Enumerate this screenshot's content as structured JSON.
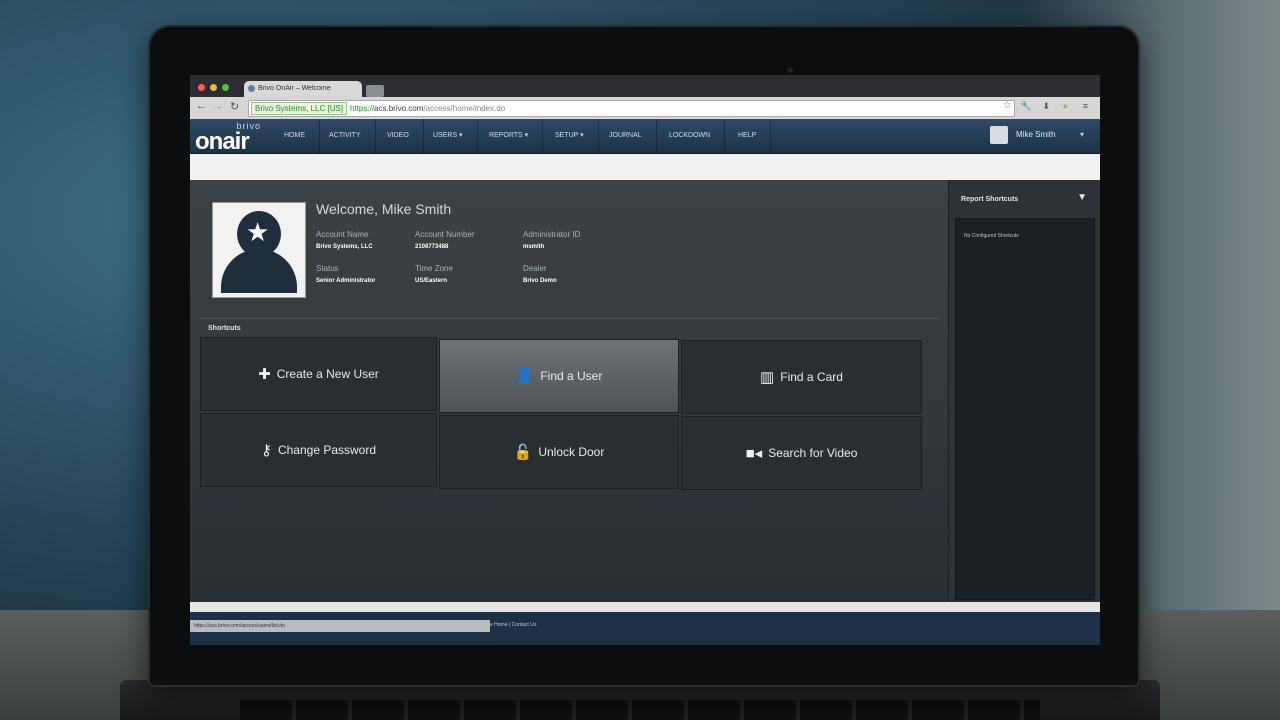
{
  "browser": {
    "tab_title": "Brivo OnAir – Welcome",
    "secure_label": "Brivo Systems, LLC [US]",
    "url_scheme": "https://",
    "url_host": "acs.brivo.com",
    "url_path": "/access/home/index.do"
  },
  "logo": {
    "brand": "brivo",
    "product": "onair"
  },
  "nav": {
    "items": [
      "HOME",
      "ACTIVITY",
      "VIDEO",
      "USERS ▾",
      "REPORTS ▾",
      "SETUP ▾",
      "JOURNAL",
      "LOCKDOWN",
      "HELP"
    ],
    "user_name": "Mike Smith",
    "user_caret": "▾"
  },
  "profile": {
    "welcome": "Welcome, Mike Smith",
    "account_name_label": "Account Name",
    "account_name": "Brivo Systems, LLC",
    "account_number_label": "Account Number",
    "account_number": "2108773488",
    "admin_id_label": "Administrator ID",
    "admin_id": "msmith",
    "status_label": "Status",
    "status": "Senior Administrator",
    "timezone_label": "Time Zone",
    "timezone": "US/Eastern",
    "dealer_label": "Dealer",
    "dealer": "Brivo Demo"
  },
  "shortcuts": {
    "title": "Shortcuts",
    "tiles": [
      {
        "label": "Create a New User",
        "icon": "plus-icon"
      },
      {
        "label": "Find a User",
        "icon": "user-icon"
      },
      {
        "label": "Find a Card",
        "icon": "card-icon"
      },
      {
        "label": "Change Password",
        "icon": "key-icon"
      },
      {
        "label": "Unlock Door",
        "icon": "unlock-icon"
      },
      {
        "label": "Search for Video",
        "icon": "video-camera-icon"
      }
    ]
  },
  "report_panel": {
    "title": "Report Shortcuts",
    "empty_text": "No Configured Shortcuts"
  },
  "status_bar": {
    "url": "https://acs.brivo.com/access/users/list.do"
  },
  "footer": {
    "links": "e Home | Contact Us"
  },
  "colors": {
    "nav_bg": "#1d3247",
    "main_bg": "#3d4247",
    "tile_bg": "#2a2d32",
    "tile_active_bg": "#5f6368",
    "secure_green": "#2e8b2e"
  }
}
